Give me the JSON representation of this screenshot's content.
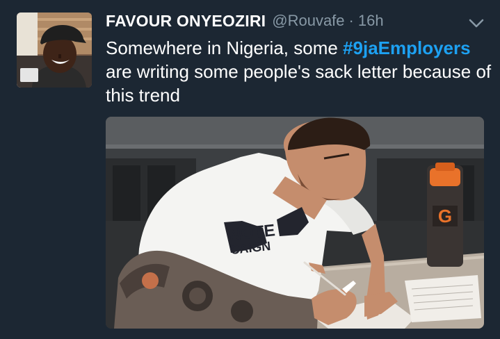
{
  "tweet": {
    "display_name": "FAVOUR ONYEOZIRI",
    "handle": "@Rouvafe",
    "separator": "·",
    "time": "16h",
    "text_before": "Somewhere in Nigeria, some ",
    "hashtag": "#9jaEmployers",
    "text_after": " are writing some people's sack letter because of this trend"
  },
  "media": {
    "shirt_print_line1": "NOTE",
    "shirt_print_line2": "CAIGN",
    "bottle_logo": "G"
  },
  "colors": {
    "background": "#1c2733",
    "text": "#ffffff",
    "secondary": "#8899a6",
    "hashtag": "#1da1f2"
  },
  "icons": {
    "caret": "chevron-down-icon"
  }
}
